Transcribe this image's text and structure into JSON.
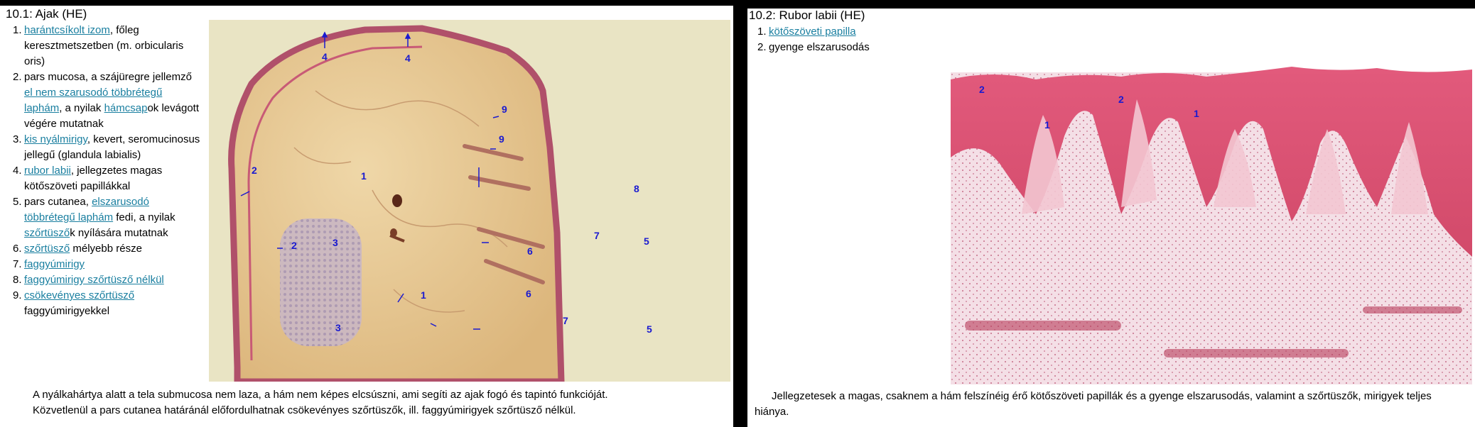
{
  "left": {
    "title": "10.1: Ajak (HE)",
    "items": [
      {
        "n": "1.",
        "link": "harántcsíkolt izom",
        "rest": ", főleg keresztmetszetben (m. orbicularis oris)"
      },
      {
        "n": "2.",
        "pre": "pars mucosa, a szájüregre jellemző ",
        "link": "el nem szarusodó többrétegű laphám",
        "rest": ", a nyilak ",
        "link2": "hámcsap",
        "rest2": "ok levágott végére mutatnak"
      },
      {
        "n": "3.",
        "link": "kis nyálmirigy",
        "rest": ", kevert, seromucinosus jellegű (glandula labialis)"
      },
      {
        "n": "4.",
        "link": "rubor labii",
        "rest": ", jellegzetes magas kötőszöveti papillákkal"
      },
      {
        "n": "5.",
        "pre": "pars cutanea, ",
        "link": "elszarusodó többrétegű laphám",
        "rest": " fedi, a nyilak ",
        "link2": "szőrtüsző",
        "rest2": "k nyílására mutatnak"
      },
      {
        "n": "6.",
        "link": "szőrtüsző",
        "rest": " mélyebb része"
      },
      {
        "n": "7.",
        "link": "faggyúmirigy",
        "rest": ""
      },
      {
        "n": "8.",
        "link": "faggyúmirigy szőrtüsző nélkül",
        "rest": ""
      },
      {
        "n": "9.",
        "link": "csökevényes szőrtüsző",
        "rest": " faggyúmirigyekkel"
      }
    ],
    "caption_l1": "A nyálkahártya alatt a tela submucosa nem laza, a hám nem képes elcsúszni, ami segíti az ajak fogó és tapintó funkcióját.",
    "caption_l2": "Közvetlenül a pars cutanea határánál előfordulhatnak csökevényes szőrtüszők, ill. faggyúmirigyek szőrtüsző nélkül.",
    "labels": [
      "4",
      "4",
      "9",
      "9",
      "2",
      "1",
      "8",
      "2",
      "3",
      "7",
      "5",
      "6",
      "1",
      "3",
      "6",
      "7",
      "5"
    ]
  },
  "right": {
    "title": "10.2: Rubor labii (HE)",
    "items": [
      {
        "n": "1.",
        "link": "kötőszöveti papilla",
        "rest": ""
      },
      {
        "n": "2.",
        "pre": "gyenge elszarusodás",
        "rest": ""
      }
    ],
    "caption": "Jellegzetesek a magas, csaknem a hám felszínéig érő kötőszöveti papillák és a gyenge elszarusodás, valamint a szőrtüszők, mirigyek teljes hiánya.",
    "labels": [
      "2",
      "2",
      "1",
      "1"
    ]
  },
  "colors": {
    "link": "#1a7fa0",
    "label": "#1a1ad0",
    "stain_pink": "#d9607a",
    "stain_tan": "#e8c890"
  }
}
